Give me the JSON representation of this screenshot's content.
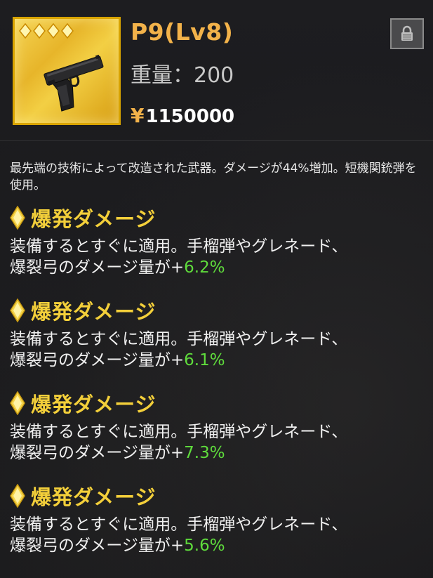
{
  "item": {
    "name": "P9(Lv8)",
    "weight_text": "重量：200",
    "currency_symbol": "¥",
    "price": "1150000",
    "rarity_stars": 4,
    "icon": "pistol-icon",
    "frame_color": "#e7b52a"
  },
  "lock_button": {
    "icon": "lock-icon"
  },
  "description": "最先端の技術によって改造された武器。ダメージが44%増加。短機関銃弾を使用。",
  "effects": [
    {
      "title": "爆発ダメージ",
      "line1": "装備するとすぐに適用。手榴弾やグレネード、",
      "line2_prefix": "爆裂弓のダメージ量が+",
      "value": "6.2%"
    },
    {
      "title": "爆発ダメージ",
      "line1": "装備するとすぐに適用。手榴弾やグレネード、",
      "line2_prefix": "爆裂弓のダメージ量が+",
      "value": "6.1%"
    },
    {
      "title": "爆発ダメージ",
      "line1": "装備するとすぐに適用。手榴弾やグレネード、",
      "line2_prefix": "爆裂弓のダメージ量が+",
      "value": "7.3%"
    },
    {
      "title": "爆発ダメージ",
      "line1": "装備するとすぐに適用。手榴弾やグレネード、",
      "line2_prefix": "爆裂弓のダメージ量が+",
      "value": "5.6%"
    }
  ],
  "colors": {
    "title_gold": "#f3cf3a",
    "name_orange": "#f2b24a",
    "value_green": "#5fdc3c"
  }
}
